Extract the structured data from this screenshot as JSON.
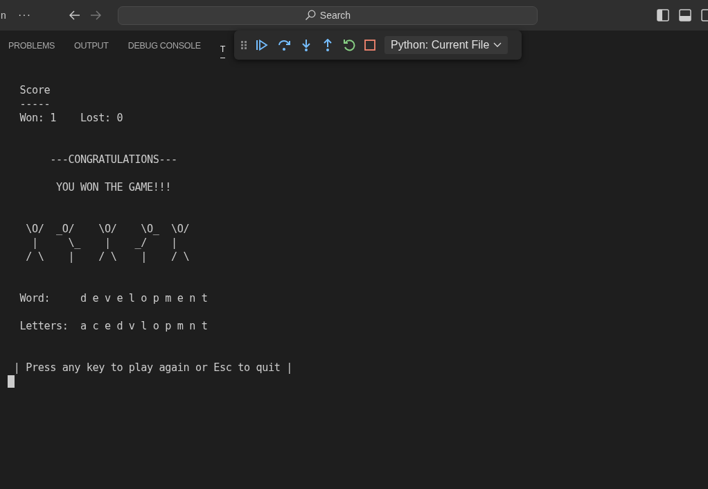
{
  "title_bar": {
    "menu_fragment": "n",
    "more": "···",
    "search": {
      "placeholder": "Search"
    }
  },
  "panel": {
    "tabs": [
      {
        "label": "PROBLEMS",
        "selected": false
      },
      {
        "label": "OUTPUT",
        "selected": false
      },
      {
        "label": "DEBUG CONSOLE",
        "selected": false
      },
      {
        "label": "T",
        "selected": true
      }
    ]
  },
  "debug_toolbar": {
    "launch_config": "Python: Current File"
  },
  "terminal": {
    "blocks": [
      {
        "kind": "score",
        "lines": [
          "  Score",
          "  -----",
          "  Won: 1    Lost: 0"
        ]
      },
      {
        "kind": "banner",
        "lines": [
          "       ---CONGRATULATIONS---"
        ]
      },
      {
        "kind": "message",
        "lines": [
          "        YOU WON THE GAME!!!"
        ]
      },
      {
        "kind": "art",
        "lines": [
          "   \\O/  _O/    \\O/    \\O_  \\O/",
          "    |     \\_    |    _/    |",
          "   / \\    |    / \\    |    / \\"
        ]
      },
      {
        "kind": "word",
        "lines": [
          "  Word:     d e v e l o p m e n t"
        ]
      },
      {
        "kind": "letters",
        "lines": [
          "  Letters:  a c e d v l o p m n t"
        ]
      },
      {
        "kind": "prompt",
        "lines": [
          " | Press any key to play again or Esc to quit |"
        ]
      }
    ],
    "cursor": true
  }
}
